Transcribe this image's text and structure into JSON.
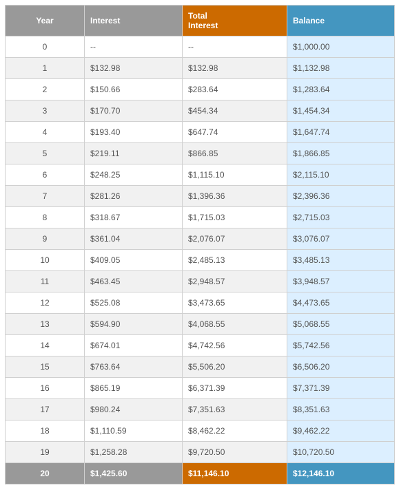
{
  "headers": {
    "year": "Year",
    "interest": "Interest",
    "total_interest_1": "Total",
    "total_interest_2": "Interest",
    "balance": "Balance"
  },
  "colors": {
    "gray": "#999999",
    "orange": "#cc6a00",
    "blue": "#4496c0",
    "light_blue": "#dcefff"
  },
  "rows": [
    {
      "year": "0",
      "interest": "--",
      "total": "--",
      "balance": "$1,000.00"
    },
    {
      "year": "1",
      "interest": "$132.98",
      "total": "$132.98",
      "balance": "$1,132.98"
    },
    {
      "year": "2",
      "interest": "$150.66",
      "total": "$283.64",
      "balance": "$1,283.64"
    },
    {
      "year": "3",
      "interest": "$170.70",
      "total": "$454.34",
      "balance": "$1,454.34"
    },
    {
      "year": "4",
      "interest": "$193.40",
      "total": "$647.74",
      "balance": "$1,647.74"
    },
    {
      "year": "5",
      "interest": "$219.11",
      "total": "$866.85",
      "balance": "$1,866.85"
    },
    {
      "year": "6",
      "interest": "$248.25",
      "total": "$1,115.10",
      "balance": "$2,115.10"
    },
    {
      "year": "7",
      "interest": "$281.26",
      "total": "$1,396.36",
      "balance": "$2,396.36"
    },
    {
      "year": "8",
      "interest": "$318.67",
      "total": "$1,715.03",
      "balance": "$2,715.03"
    },
    {
      "year": "9",
      "interest": "$361.04",
      "total": "$2,076.07",
      "balance": "$3,076.07"
    },
    {
      "year": "10",
      "interest": "$409.05",
      "total": "$2,485.13",
      "balance": "$3,485.13"
    },
    {
      "year": "11",
      "interest": "$463.45",
      "total": "$2,948.57",
      "balance": "$3,948.57"
    },
    {
      "year": "12",
      "interest": "$525.08",
      "total": "$3,473.65",
      "balance": "$4,473.65"
    },
    {
      "year": "13",
      "interest": "$594.90",
      "total": "$4,068.55",
      "balance": "$5,068.55"
    },
    {
      "year": "14",
      "interest": "$674.01",
      "total": "$4,742.56",
      "balance": "$5,742.56"
    },
    {
      "year": "15",
      "interest": "$763.64",
      "total": "$5,506.20",
      "balance": "$6,506.20"
    },
    {
      "year": "16",
      "interest": "$865.19",
      "total": "$6,371.39",
      "balance": "$7,371.39"
    },
    {
      "year": "17",
      "interest": "$980.24",
      "total": "$7,351.63",
      "balance": "$8,351.63"
    },
    {
      "year": "18",
      "interest": "$1,110.59",
      "total": "$8,462.22",
      "balance": "$9,462.22"
    },
    {
      "year": "19",
      "interest": "$1,258.28",
      "total": "$9,720.50",
      "balance": "$10,720.50"
    }
  ],
  "final": {
    "year": "20",
    "interest": "$1,425.60",
    "total": "$11,146.10",
    "balance": "$12,146.10"
  }
}
